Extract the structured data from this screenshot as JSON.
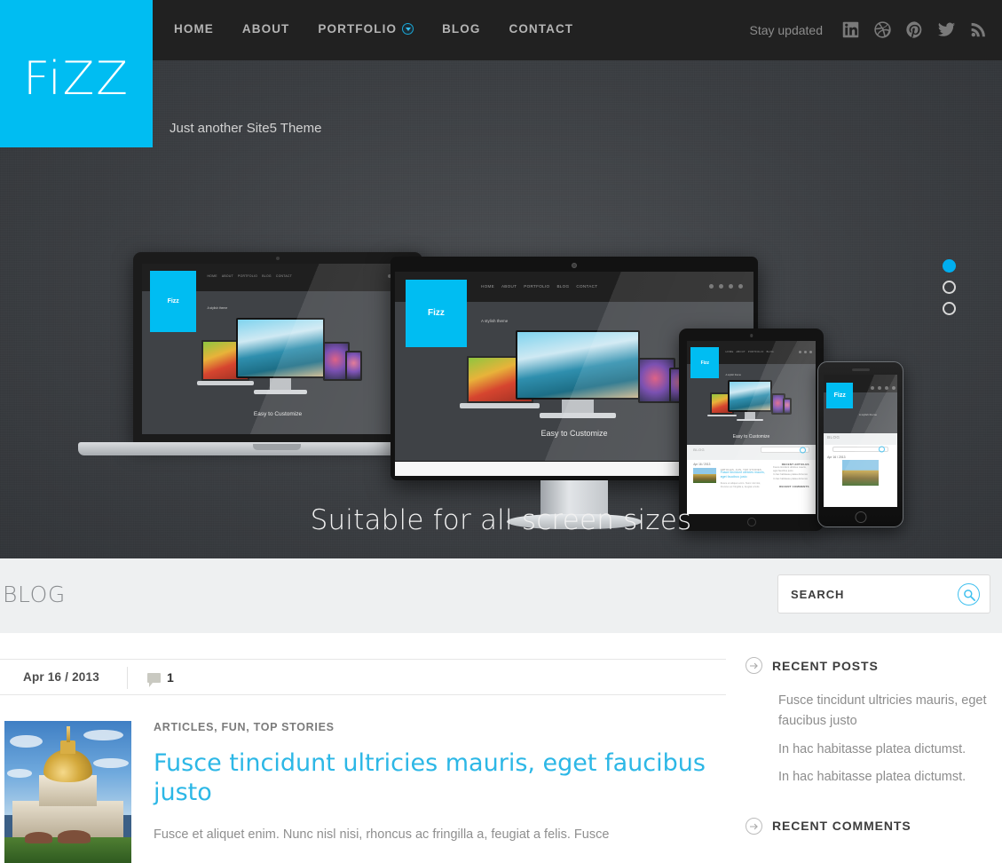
{
  "site": {
    "logo_text": "FiZZ",
    "tagline": "Just another Site5 Theme",
    "accent_color": "#00bdf2",
    "header_bg": "#212121",
    "hero_bg": "#3f4246"
  },
  "nav": {
    "items": [
      {
        "label": "HOME",
        "has_dropdown": false
      },
      {
        "label": "ABOUT",
        "has_dropdown": false
      },
      {
        "label": "PORTFOLIO",
        "has_dropdown": true,
        "dropdown_icon": "chevron-down-circle-icon"
      },
      {
        "label": "BLOG",
        "has_dropdown": false
      },
      {
        "label": "CONTACT",
        "has_dropdown": false
      }
    ]
  },
  "social": {
    "label": "Stay updated",
    "icons": [
      {
        "name": "linkedin-icon"
      },
      {
        "name": "dribbble-icon"
      },
      {
        "name": "pinterest-icon"
      },
      {
        "name": "twitter-icon"
      },
      {
        "name": "rss-icon"
      }
    ]
  },
  "hero": {
    "caption": "Suitable for all screen sizes",
    "slider_dots": [
      {
        "active": true
      },
      {
        "active": false
      },
      {
        "active": false
      }
    ],
    "mockup": {
      "logo_text": "Fizz",
      "tagline": "A stylish theme",
      "caption": "Easy to Customize",
      "nav": [
        "HOME",
        "ABOUT",
        "PORTFOLIO",
        "BLOG",
        "CONTACT"
      ],
      "blog_heading": "BLOG",
      "blog_search_placeholder": "SEARCH",
      "blog_date": "Apr 16 / 2013",
      "blog_cats": "ARTICLES, FUN, TOP STORIES",
      "blog_title": "Fusce tincidunt ultricies mauris, eget faucibus justo",
      "blog_excerpt": "Fusce et aliquet enim. Nunc nisl nisi, rhoncus ac fringilla a, feugiat a felis.",
      "side_title_1": "RECENT ARTICLES",
      "side_items_1": [
        "Fusce tincidunt ultricies mauris, eget faucibus justo",
        "In hac habitasse platea dictumst.",
        "In hac habitasse platea dictumst."
      ],
      "side_title_2": "RECENT COMMENTS"
    }
  },
  "blog_band": {
    "heading": "BLOG",
    "search": {
      "value": "SEARCH",
      "placeholder": "SEARCH",
      "icon": "search-icon"
    }
  },
  "post": {
    "date": "Apr 16 / 2013",
    "comment_count": "1",
    "comment_icon": "comment-bubble-icon",
    "categories": "ARTICLES, FUN, TOP STORIES",
    "title": "Fusce tincidunt ultricies mauris, eget faucibus justo",
    "excerpt": "Fusce et aliquet enim. Nunc nisl nisi, rhoncus ac fringilla a, feugiat a felis. Fusce",
    "thumbnail_alt": "golden domed cathedral building"
  },
  "sidebar": {
    "widgets": [
      {
        "title": "RECENT POSTS",
        "icon": "arrow-right-circle-icon",
        "items": [
          "Fusce tincidunt ultricies mauris, eget faucibus justo",
          "In hac habitasse platea dictumst.",
          "In hac habitasse platea dictumst."
        ]
      },
      {
        "title": "RECENT COMMENTS",
        "icon": "arrow-right-circle-icon",
        "items": []
      }
    ]
  }
}
